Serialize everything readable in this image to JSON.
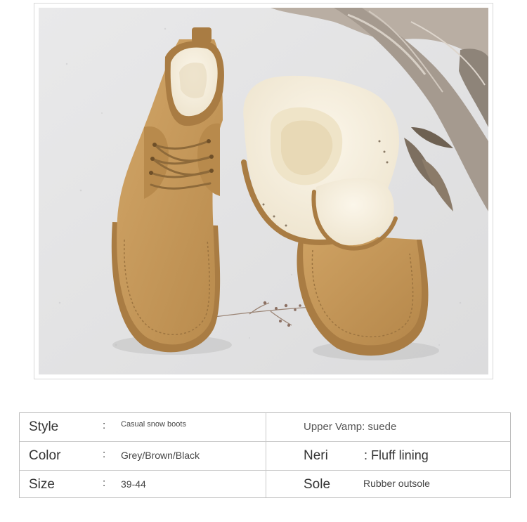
{
  "specs": {
    "rows": [
      {
        "label": "Style",
        "colon": ":",
        "value": "Casual snow boots",
        "right_text": "Upper Vamp: suede"
      },
      {
        "label": "Color",
        "colon": ":",
        "value": "Grey/Brown/Black",
        "right_label": "Neri",
        "right_colon": ":",
        "right_value": "Fluff lining"
      },
      {
        "label": "Size",
        "colon": ":",
        "value": "39-44",
        "right_label": "Sole",
        "right_value": "Rubber outsole"
      }
    ]
  },
  "colors": {
    "suede": "#c79a5c",
    "suede_dark": "#9c7440",
    "fur": "#f7f1e3",
    "background_sand": "#e6e6e6",
    "table_border": "#bdbdbd"
  }
}
